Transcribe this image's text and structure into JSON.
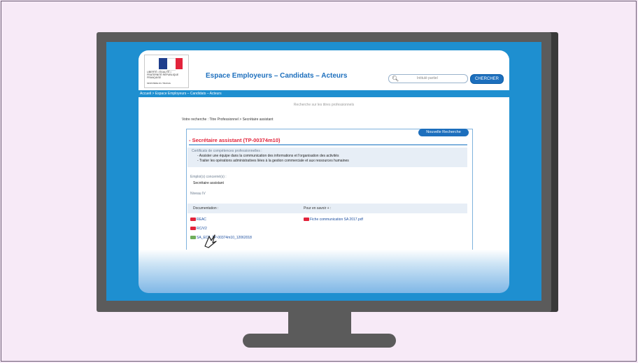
{
  "header": {
    "logo_text": "Liberté • Égalité • Fraternité RÉPUBLIQUE FRANÇAISE",
    "ministry": "MINISTÈRE DU TRAVAIL",
    "site_title": "Espace Employeurs – Candidats – Acteurs",
    "search_placeholder": "Intitulé partiel",
    "search_button": "CHERCHER"
  },
  "nav": {
    "breadcrumb": "Accueil > Espace Employeurs – Candidats – Acteurs"
  },
  "main": {
    "subtitle": "Recherche sur les titres professionnels",
    "search_recap": "Votre recherche :  Titre Professionnel > Secrétaire assistant",
    "new_search": "Nouvelle Recherche",
    "result_title": "- Secrétaire assistant (TP-00374m10)",
    "cert_title": "Certificats de compétences professionnelles :",
    "cert_items": [
      "- Assister une équipe dans la communication des informations et l'organisation des activités",
      "- Traiter les opérations administratives liées à la gestion commerciale et aux ressources humaines"
    ],
    "emploi_title": "Emploi(s) concerné(s) :",
    "emploi_value": "Secrétaire assistant",
    "niveau": "Niveau IV",
    "doc_header": "Documentation :",
    "more_header": "Pour en savoir + :",
    "docs": [
      "REAC",
      "RC/V2",
      "SA_ECF_TP-00374m10_12062018"
    ],
    "more_docs": [
      "Fiche communication SA 2017.pdf"
    ]
  },
  "colors": {
    "accent_blue": "#1d6fbd",
    "title_red": "#e2233b",
    "background": "#f6e9f6",
    "monitor": "#5b5b5b"
  }
}
